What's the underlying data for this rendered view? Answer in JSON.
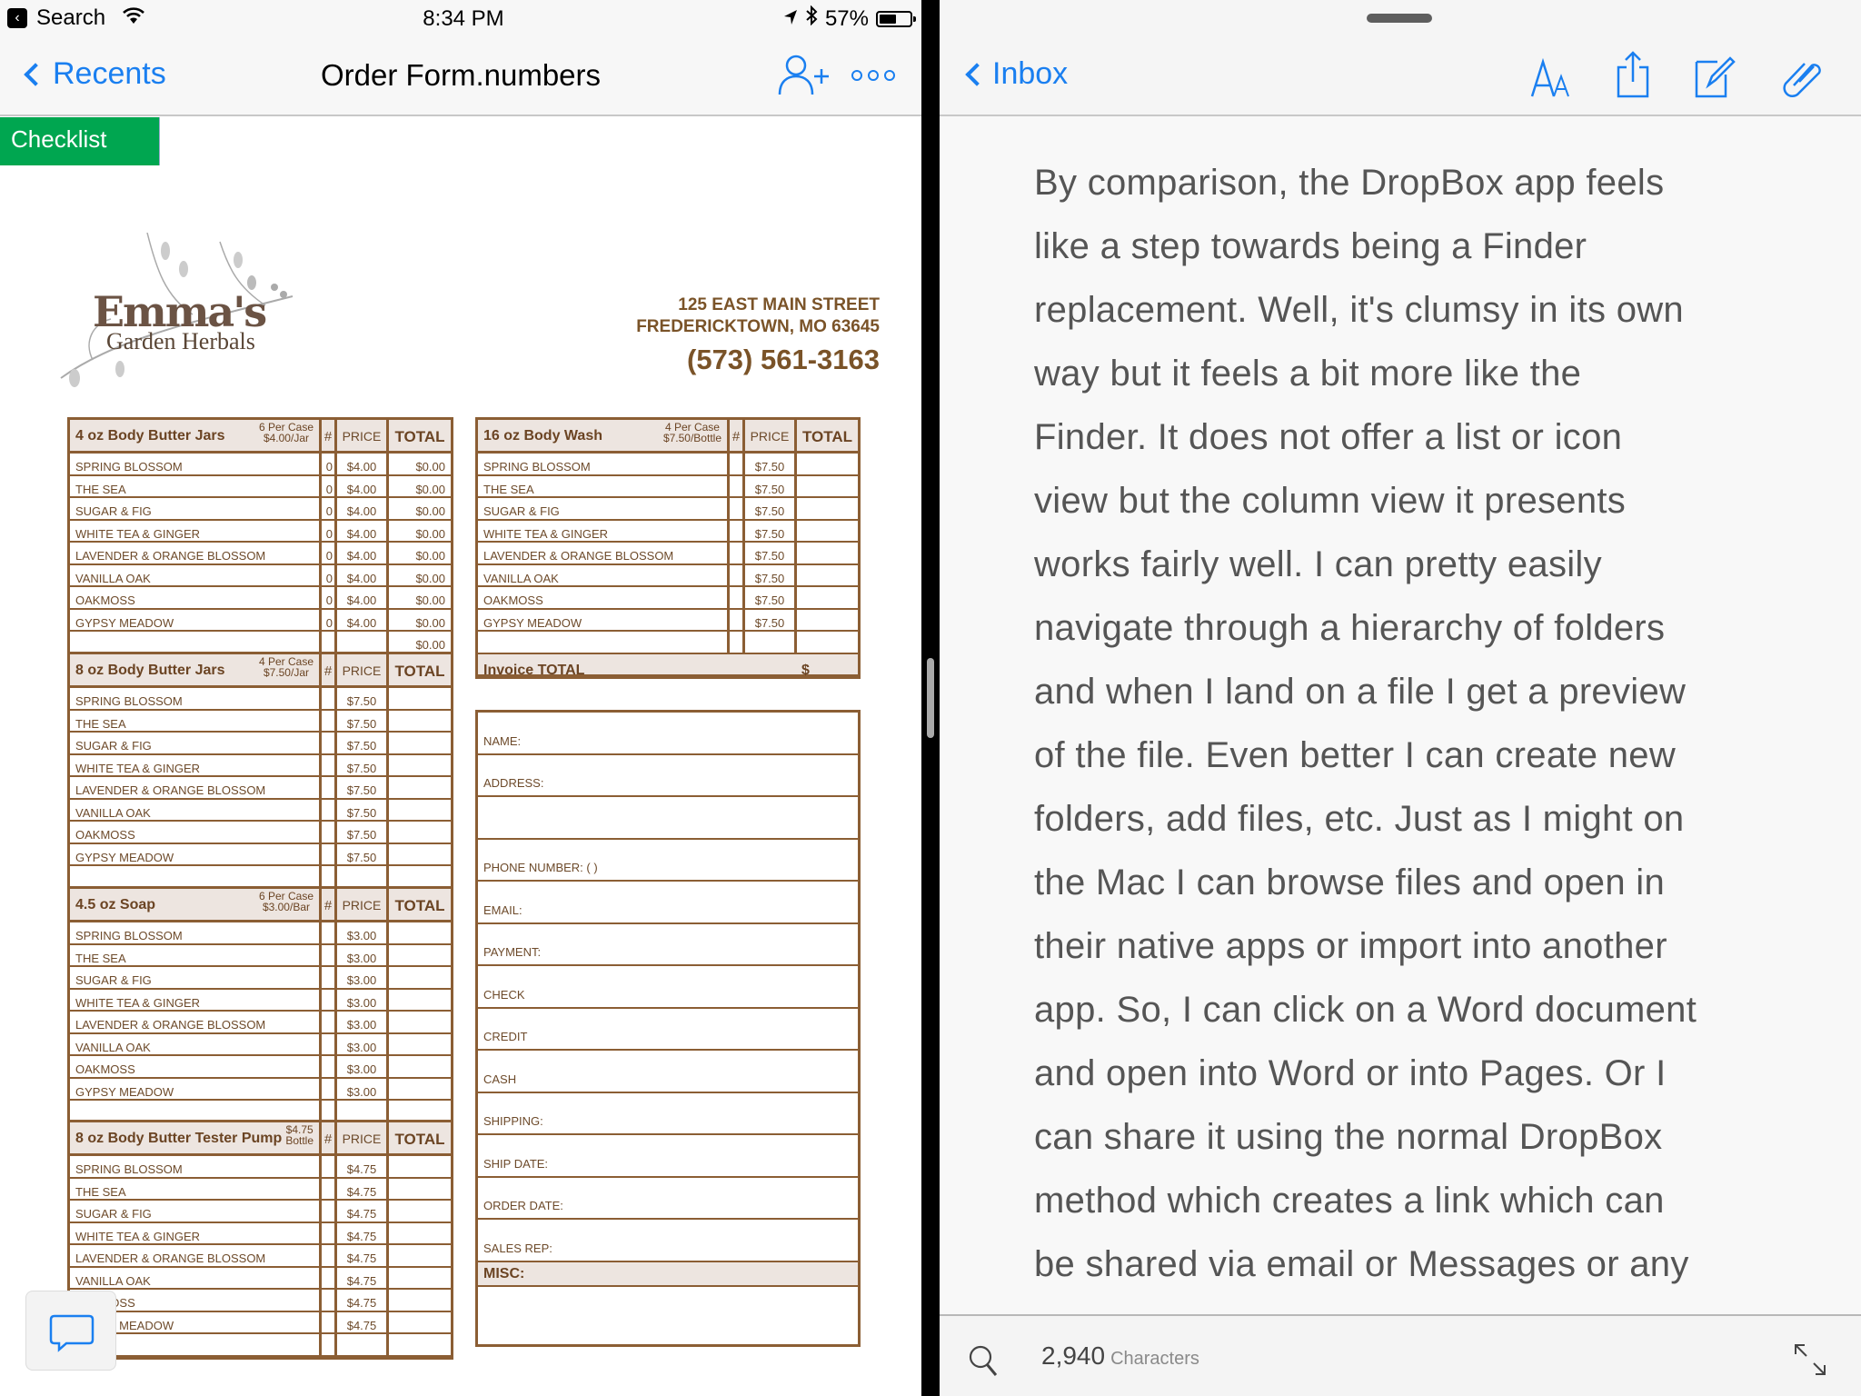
{
  "status_bar": {
    "back_app": "Search",
    "time": "8:34 PM",
    "battery_percent_label": "57%",
    "battery_level": 0.57
  },
  "left_app": {
    "nav": {
      "back_label": "Recents",
      "title": "Order Form.numbers"
    },
    "sheet_tab": "Checklist",
    "accent_color": "#1a7ff0",
    "sheet_tab_color": "#00a650"
  },
  "form": {
    "logo": {
      "name": "Emma's",
      "subtitle": "Garden Herbals"
    },
    "address_line1": "125 EAST MAIN STREET",
    "address_line2": "FREDERICKTOWN, MO 63645",
    "phone": "(573) 561-3163",
    "column_headers": {
      "num": "#",
      "price": "PRICE",
      "total": "TOTAL"
    },
    "tables": [
      {
        "title": "4 oz Body Butter Jars",
        "case_line1": "6 Per Case",
        "case_line2": "$4.00/Jar",
        "rows": [
          {
            "name": "SPRING BLOSSOM",
            "num": "0",
            "price": "$4.00",
            "total": "$0.00"
          },
          {
            "name": "THE SEA",
            "num": "0",
            "price": "$4.00",
            "total": "$0.00"
          },
          {
            "name": "SUGAR & FIG",
            "num": "0",
            "price": "$4.00",
            "total": "$0.00"
          },
          {
            "name": "WHITE TEA & GINGER",
            "num": "0",
            "price": "$4.00",
            "total": "$0.00"
          },
          {
            "name": "LAVENDER & ORANGE BLOSSOM",
            "num": "0",
            "price": "$4.00",
            "total": "$0.00"
          },
          {
            "name": "VANILLA OAK",
            "num": "0",
            "price": "$4.00",
            "total": "$0.00"
          },
          {
            "name": "OAKMOSS",
            "num": "0",
            "price": "$4.00",
            "total": "$0.00"
          },
          {
            "name": "GYPSY MEADOW",
            "num": "0",
            "price": "$4.00",
            "total": "$0.00"
          },
          {
            "name": "",
            "num": "",
            "price": "",
            "total": "$0.00"
          }
        ]
      },
      {
        "title": "8 oz Body Butter Jars",
        "case_line1": "4 Per Case",
        "case_line2": "$7.50/Jar",
        "rows": [
          {
            "name": "SPRING BLOSSOM",
            "num": "",
            "price": "$7.50",
            "total": ""
          },
          {
            "name": "THE SEA",
            "num": "",
            "price": "$7.50",
            "total": ""
          },
          {
            "name": "SUGAR & FIG",
            "num": "",
            "price": "$7.50",
            "total": ""
          },
          {
            "name": "WHITE TEA & GINGER",
            "num": "",
            "price": "$7.50",
            "total": ""
          },
          {
            "name": "LAVENDER & ORANGE BLOSSOM",
            "num": "",
            "price": "$7.50",
            "total": ""
          },
          {
            "name": "VANILLA OAK",
            "num": "",
            "price": "$7.50",
            "total": ""
          },
          {
            "name": "OAKMOSS",
            "num": "",
            "price": "$7.50",
            "total": ""
          },
          {
            "name": "GYPSY MEADOW",
            "num": "",
            "price": "$7.50",
            "total": ""
          },
          {
            "name": "",
            "num": "",
            "price": "",
            "total": ""
          }
        ]
      },
      {
        "title": "4.5 oz Soap",
        "case_line1": "6 Per Case",
        "case_line2": "$3.00/Bar",
        "rows": [
          {
            "name": "SPRING BLOSSOM",
            "num": "",
            "price": "$3.00",
            "total": ""
          },
          {
            "name": "THE SEA",
            "num": "",
            "price": "$3.00",
            "total": ""
          },
          {
            "name": "SUGAR & FIG",
            "num": "",
            "price": "$3.00",
            "total": ""
          },
          {
            "name": "WHITE TEA & GINGER",
            "num": "",
            "price": "$3.00",
            "total": ""
          },
          {
            "name": "LAVENDER & ORANGE BLOSSOM",
            "num": "",
            "price": "$3.00",
            "total": ""
          },
          {
            "name": "VANILLA OAK",
            "num": "",
            "price": "$3.00",
            "total": ""
          },
          {
            "name": "OAKMOSS",
            "num": "",
            "price": "$3.00",
            "total": ""
          },
          {
            "name": "GYPSY MEADOW",
            "num": "",
            "price": "$3.00",
            "total": ""
          },
          {
            "name": "",
            "num": "",
            "price": "",
            "total": ""
          }
        ]
      },
      {
        "title": "8 oz Body Butter Tester Pump",
        "case_line1": "$4.75",
        "case_line2": "Bottle",
        "rows": [
          {
            "name": "SPRING BLOSSOM",
            "num": "",
            "price": "$4.75",
            "total": ""
          },
          {
            "name": "THE SEA",
            "num": "",
            "price": "$4.75",
            "total": ""
          },
          {
            "name": "SUGAR & FIG",
            "num": "",
            "price": "$4.75",
            "total": ""
          },
          {
            "name": "WHITE TEA & GINGER",
            "num": "",
            "price": "$4.75",
            "total": ""
          },
          {
            "name": "LAVENDER & ORANGE BLOSSOM",
            "num": "",
            "price": "$4.75",
            "total": ""
          },
          {
            "name": "VANILLA OAK",
            "num": "",
            "price": "$4.75",
            "total": ""
          },
          {
            "name": "OAKMOSS",
            "num": "",
            "price": "$4.75",
            "total": ""
          },
          {
            "name": "GYPSY MEADOW",
            "num": "",
            "price": "$4.75",
            "total": ""
          },
          {
            "name": "",
            "num": "",
            "price": "",
            "total": ""
          }
        ]
      },
      {
        "title": "16 oz Body Wash",
        "case_line1": "4 Per Case",
        "case_line2": "$7.50/Bottle",
        "rows": [
          {
            "name": "SPRING BLOSSOM",
            "num": "",
            "price": "$7.50",
            "total": ""
          },
          {
            "name": "THE SEA",
            "num": "",
            "price": "$7.50",
            "total": ""
          },
          {
            "name": "SUGAR & FIG",
            "num": "",
            "price": "$7.50",
            "total": ""
          },
          {
            "name": "WHITE TEA & GINGER",
            "num": "",
            "price": "$7.50",
            "total": ""
          },
          {
            "name": "LAVENDER & ORANGE BLOSSOM",
            "num": "",
            "price": "$7.50",
            "total": ""
          },
          {
            "name": "VANILLA OAK",
            "num": "",
            "price": "$7.50",
            "total": ""
          },
          {
            "name": "OAKMOSS",
            "num": "",
            "price": "$7.50",
            "total": ""
          },
          {
            "name": "GYPSY MEADOW",
            "num": "",
            "price": "$7.50",
            "total": ""
          },
          {
            "name": "",
            "num": "",
            "price": "",
            "total": ""
          }
        ]
      }
    ],
    "invoice_total_label": "Invoice TOTAL",
    "invoice_total_value": "$",
    "customer_fields": [
      "NAME:",
      "ADDRESS:",
      "",
      "PHONE NUMBER: (          )",
      "EMAIL:",
      "PAYMENT:",
      "CHECK",
      "CREDIT",
      "CASH",
      "SHIPPING:",
      "SHIP DATE:",
      "ORDER DATE:",
      "SALES REP:"
    ],
    "misc_label": "MISC:"
  },
  "right_app": {
    "nav": {
      "back_label": "Inbox",
      "icons": [
        "text-size-icon",
        "share-icon",
        "compose-icon",
        "attachment-icon"
      ]
    },
    "body_lines": [
      "By comparison, the DropBox app feels",
      "like a step towards being a Finder",
      "replacement. Well, it's clumsy in its own",
      "way but it feels a bit more like the",
      "Finder. It does not offer a list or icon",
      "view but the column view it presents",
      "works fairly well. I can pretty easily",
      "navigate through a hierarchy of folders",
      "and when I land on a file I get a preview",
      "of the file. Even better I can create new",
      "folders, add files, etc. Just as I might on",
      "the Mac I can browse files and open in",
      "their native apps or import into another",
      "app. So, I can click on a Word document",
      "and open into Word or into Pages. Or I",
      "can share it using the normal DropBox",
      "method which creates a link which can",
      "be shared via email or Messages or any"
    ],
    "footer": {
      "count": "2,940",
      "count_label": "Characters"
    }
  }
}
